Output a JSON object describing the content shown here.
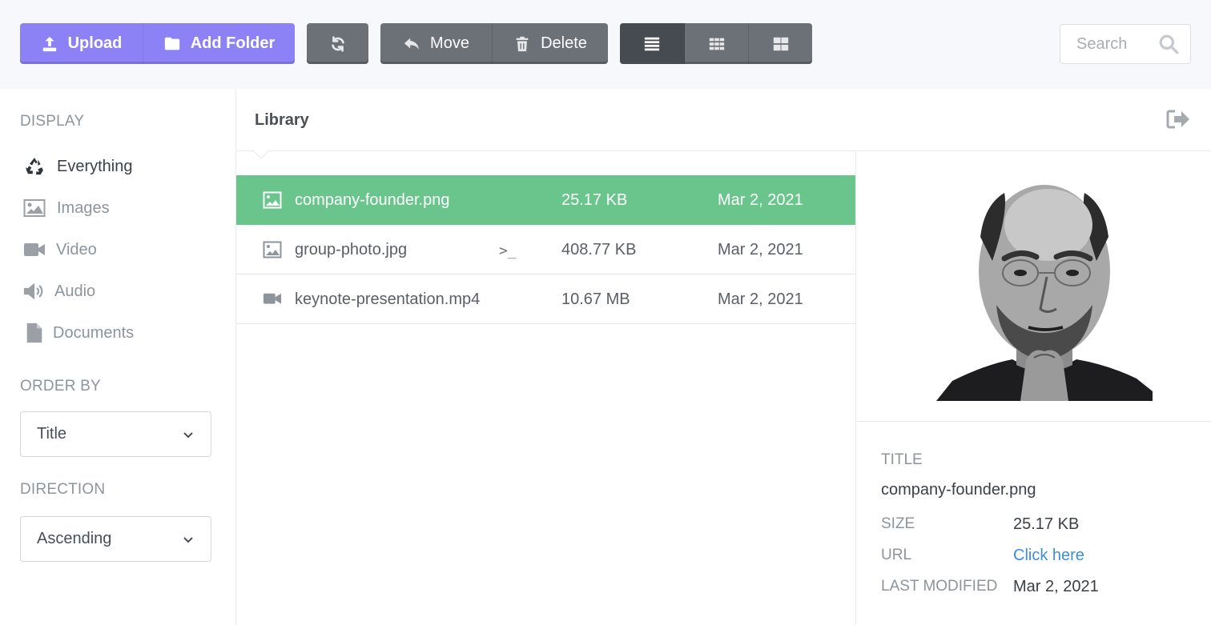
{
  "toolbar": {
    "upload_label": "Upload",
    "add_folder_label": "Add Folder",
    "move_label": "Move",
    "delete_label": "Delete",
    "search_placeholder": "Search"
  },
  "sidebar": {
    "display_title": "DISPLAY",
    "items": [
      {
        "label": "Everything",
        "icon": "recycle-icon"
      },
      {
        "label": "Images",
        "icon": "image-icon"
      },
      {
        "label": "Video",
        "icon": "video-icon"
      },
      {
        "label": "Audio",
        "icon": "volume-icon"
      },
      {
        "label": "Documents",
        "icon": "file-icon"
      }
    ],
    "order_by_title": "ORDER BY",
    "order_by_value": "Title",
    "direction_title": "DIRECTION",
    "direction_value": "Ascending"
  },
  "library": {
    "title": "Library",
    "files": [
      {
        "name": "company-founder.png",
        "size": "25.17 KB",
        "date": "Mar 2, 2021",
        "type": "image",
        "selected": true
      },
      {
        "name": "group-photo.jpg",
        "size": "408.77 KB",
        "date": "Mar 2, 2021",
        "type": "image",
        "selected": false
      },
      {
        "name": "keynote-presentation.mp4",
        "size": "10.67 MB",
        "date": "Mar 2, 2021",
        "type": "video",
        "selected": false
      }
    ],
    "terminal_glyph": ">_"
  },
  "detail": {
    "title_label": "TITLE",
    "title_value": "company-founder.png",
    "size_label": "SIZE",
    "size_value": "25.17 KB",
    "url_label": "URL",
    "url_value": "Click here",
    "modified_label": "LAST MODIFIED",
    "modified_value": "Mar 2, 2021"
  },
  "colors": {
    "primary": "#8c82f5",
    "toolbar_dark": "#6c7178",
    "selected_row": "#6ac58d",
    "link": "#3d8fd6"
  }
}
